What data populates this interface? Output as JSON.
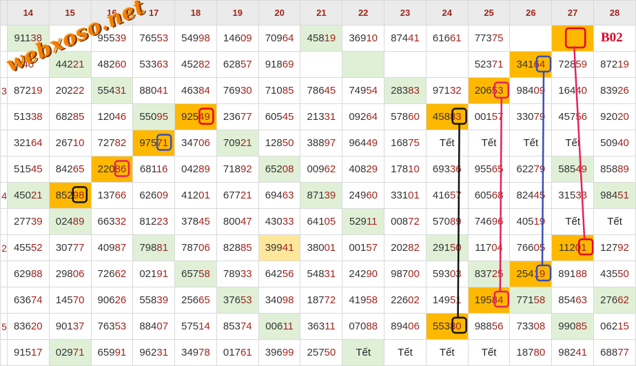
{
  "watermark": "webxoso.net",
  "badge": "B02",
  "columns": [
    "14",
    "15",
    "16",
    "17",
    "18",
    "19",
    "20",
    "21",
    "22",
    "23",
    "24",
    "25",
    "26",
    "27",
    "28"
  ],
  "rows": [
    [
      {
        "v": "91138",
        "b": "g"
      },
      {
        "v": "63"
      },
      {
        "v": "95539"
      },
      {
        "v": "76553"
      },
      {
        "v": "54998"
      },
      {
        "v": "14609"
      },
      {
        "v": "70964"
      },
      {
        "v": "45819",
        "b": "g"
      },
      {
        "v": "36910"
      },
      {
        "v": "87441"
      },
      {
        "v": "61661"
      },
      {
        "v": "77375"
      },
      {
        "v": ""
      },
      {
        "v": "",
        "b": "o"
      },
      {
        "v": ""
      }
    ],
    [
      {
        "v": "40"
      },
      {
        "v": "44221",
        "b": "g"
      },
      {
        "v": "48260"
      },
      {
        "v": "53363"
      },
      {
        "v": "45282"
      },
      {
        "v": "62857"
      },
      {
        "v": "91869"
      },
      {
        "v": ""
      },
      {
        "v": "",
        "b": "g"
      },
      {
        "v": ""
      },
      {
        "v": ""
      },
      {
        "v": "52371"
      },
      {
        "v": "34164",
        "b": "o"
      },
      {
        "v": "72859"
      },
      {
        "v": "87219"
      }
    ],
    [
      {
        "v": "87219"
      },
      {
        "v": "20222"
      },
      {
        "v": "55431",
        "b": "g"
      },
      {
        "v": "88041"
      },
      {
        "v": "46384"
      },
      {
        "v": "76930"
      },
      {
        "v": "71085"
      },
      {
        "v": "78645"
      },
      {
        "v": "74954"
      },
      {
        "v": "28383",
        "b": "g"
      },
      {
        "v": "97132"
      },
      {
        "v": "20653",
        "b": "o"
      },
      {
        "v": "98409"
      },
      {
        "v": "16440"
      },
      {
        "v": "83926"
      }
    ],
    [
      {
        "v": "51338"
      },
      {
        "v": "68285"
      },
      {
        "v": "12046"
      },
      {
        "v": "55095",
        "b": "g"
      },
      {
        "v": "92549",
        "b": "o"
      },
      {
        "v": "23677"
      },
      {
        "v": "60545"
      },
      {
        "v": "21331"
      },
      {
        "v": "09264"
      },
      {
        "v": "57860"
      },
      {
        "v": "45883",
        "b": "o"
      },
      {
        "v": "00157"
      },
      {
        "v": "33079"
      },
      {
        "v": "45756"
      },
      {
        "v": "92020"
      }
    ],
    [
      {
        "v": "32164"
      },
      {
        "v": "26710"
      },
      {
        "v": "72782"
      },
      {
        "v": "97571",
        "b": "o"
      },
      {
        "v": "34706"
      },
      {
        "v": "70921",
        "b": "g"
      },
      {
        "v": "12850"
      },
      {
        "v": "38897"
      },
      {
        "v": "96449"
      },
      {
        "v": "16875"
      },
      {
        "v": "Tết"
      },
      {
        "v": "Tết"
      },
      {
        "v": "Tết"
      },
      {
        "v": "Tết"
      },
      {
        "v": "50940"
      }
    ],
    [
      {
        "v": "51545"
      },
      {
        "v": "84265"
      },
      {
        "v": "22086",
        "b": "o"
      },
      {
        "v": "68116"
      },
      {
        "v": "04289"
      },
      {
        "v": "71892"
      },
      {
        "v": "65208",
        "b": "g"
      },
      {
        "v": "00962"
      },
      {
        "v": "40829"
      },
      {
        "v": "17810"
      },
      {
        "v": "69336"
      },
      {
        "v": "95565"
      },
      {
        "v": "62279"
      },
      {
        "v": "58549",
        "b": "g"
      },
      {
        "v": "85889"
      }
    ],
    [
      {
        "v": "45021",
        "b": "g"
      },
      {
        "v": "85298",
        "b": "o"
      },
      {
        "v": "13766"
      },
      {
        "v": "62609"
      },
      {
        "v": "41201"
      },
      {
        "v": "67721"
      },
      {
        "v": "69463"
      },
      {
        "v": "87139",
        "b": "g"
      },
      {
        "v": "24960"
      },
      {
        "v": "33101"
      },
      {
        "v": "41657"
      },
      {
        "v": "60568"
      },
      {
        "v": "82445"
      },
      {
        "v": "31533"
      },
      {
        "v": "98451",
        "b": "g"
      }
    ],
    [
      {
        "v": "27739"
      },
      {
        "v": "02489",
        "b": "g"
      },
      {
        "v": "66332"
      },
      {
        "v": "81223"
      },
      {
        "v": "37845"
      },
      {
        "v": "80047"
      },
      {
        "v": "43033"
      },
      {
        "v": "64105"
      },
      {
        "v": "52911",
        "b": "g"
      },
      {
        "v": "00872"
      },
      {
        "v": "57089"
      },
      {
        "v": "74696"
      },
      {
        "v": "40519"
      },
      {
        "v": "Tết"
      },
      {
        "v": "Tết"
      }
    ],
    [
      {
        "v": "45552"
      },
      {
        "v": "30777"
      },
      {
        "v": "40987"
      },
      {
        "v": "79881",
        "b": "g"
      },
      {
        "v": "78706"
      },
      {
        "v": "82885"
      },
      {
        "v": "39941",
        "b": "y"
      },
      {
        "v": "38001"
      },
      {
        "v": "00157"
      },
      {
        "v": "20282"
      },
      {
        "v": "29150",
        "b": "g"
      },
      {
        "v": "11704"
      },
      {
        "v": "76605"
      },
      {
        "v": "11201",
        "b": "o"
      },
      {
        "v": "12792"
      }
    ],
    [
      {
        "v": "62988"
      },
      {
        "v": "29806"
      },
      {
        "v": "72662"
      },
      {
        "v": "02191"
      },
      {
        "v": "65758",
        "b": "g"
      },
      {
        "v": "78933"
      },
      {
        "v": "64256"
      },
      {
        "v": "54831"
      },
      {
        "v": "24290"
      },
      {
        "v": "98700"
      },
      {
        "v": "59303"
      },
      {
        "v": "83725",
        "b": "g"
      },
      {
        "v": "25419",
        "b": "o"
      },
      {
        "v": "89188"
      },
      {
        "v": "43550"
      }
    ],
    [
      {
        "v": "63674"
      },
      {
        "v": "14570"
      },
      {
        "v": "90626"
      },
      {
        "v": "55839"
      },
      {
        "v": "25665"
      },
      {
        "v": "37653",
        "b": "g"
      },
      {
        "v": "34098"
      },
      {
        "v": "18772"
      },
      {
        "v": "41958"
      },
      {
        "v": "22602"
      },
      {
        "v": "14951"
      },
      {
        "v": "19584",
        "b": "o"
      },
      {
        "v": "77158",
        "b": "g"
      },
      {
        "v": "85463"
      },
      {
        "v": "27662",
        "b": "g"
      }
    ],
    [
      {
        "v": "83620"
      },
      {
        "v": "90137"
      },
      {
        "v": "76353"
      },
      {
        "v": "88407"
      },
      {
        "v": "57514"
      },
      {
        "v": "85374"
      },
      {
        "v": "00611",
        "b": "g"
      },
      {
        "v": "36311"
      },
      {
        "v": "07088"
      },
      {
        "v": "89406"
      },
      {
        "v": "55380",
        "b": "o"
      },
      {
        "v": "98856"
      },
      {
        "v": "73308"
      },
      {
        "v": "99085",
        "b": "g"
      },
      {
        "v": "06215"
      }
    ],
    [
      {
        "v": "91517"
      },
      {
        "v": "02971",
        "b": "g"
      },
      {
        "v": "65991"
      },
      {
        "v": "96231"
      },
      {
        "v": "34978"
      },
      {
        "v": "01761"
      },
      {
        "v": "39699"
      },
      {
        "v": "25750"
      },
      {
        "v": "Tết",
        "b": "g"
      },
      {
        "v": "Tết"
      },
      {
        "v": "Tết"
      },
      {
        "v": "Tết"
      },
      {
        "v": "18780"
      },
      {
        "v": "98241"
      },
      {
        "v": "68877"
      }
    ]
  ],
  "row_prefixes": [
    "",
    "",
    "3",
    "",
    "",
    "",
    "4",
    "",
    "2",
    "",
    "",
    "5",
    ""
  ],
  "highlights": [
    {
      "row": 3,
      "col": 4,
      "color": "#e8001a"
    },
    {
      "row": 4,
      "col": 3,
      "color": "#3a4fb8"
    },
    {
      "row": 5,
      "col": 2,
      "color": "#e8205a"
    },
    {
      "row": 6,
      "col": 1,
      "color": "#111111"
    },
    {
      "row": 0,
      "col": 13,
      "color": "#e8001a"
    },
    {
      "row": 1,
      "col": 12,
      "color": "#3a4fb8"
    },
    {
      "row": 2,
      "col": 11,
      "color": "#e8205a"
    },
    {
      "row": 3,
      "col": 10,
      "color": "#111111"
    },
    {
      "row": 8,
      "col": 13,
      "color": "#e8001a"
    },
    {
      "row": 9,
      "col": 12,
      "color": "#3a4fb8"
    },
    {
      "row": 10,
      "col": 11,
      "color": "#e8205a"
    },
    {
      "row": 11,
      "col": 10,
      "color": "#111111"
    }
  ],
  "links": [
    {
      "from": [
        0,
        13
      ],
      "to": [
        8,
        13
      ],
      "color": "#e8205a"
    },
    {
      "from": [
        1,
        12
      ],
      "to": [
        9,
        12
      ],
      "color": "#3a4fb8"
    },
    {
      "from": [
        2,
        11
      ],
      "to": [
        10,
        11
      ],
      "color": "#e8205a"
    },
    {
      "from": [
        3,
        10
      ],
      "to": [
        11,
        10
      ],
      "color": "#111111"
    }
  ]
}
